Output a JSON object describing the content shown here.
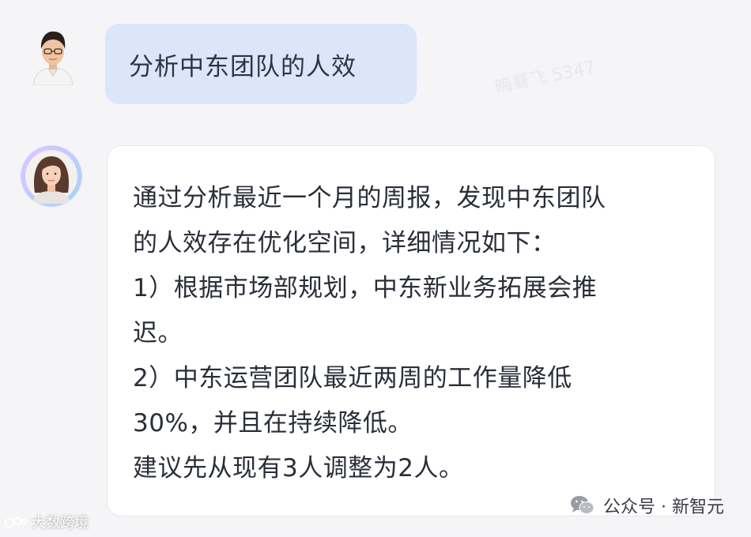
{
  "watermark": {
    "text": "晦蓦飞 5347"
  },
  "user_message": {
    "text": "分析中东团队的人效"
  },
  "ai_message": {
    "lines": [
      "通过分析最近一个月的周报，发现中东团队",
      "的人效存在优化空间，详细情况如下：",
      "1）根据市场部规划，中东新业务拓展会推",
      "迟。",
      "2）中东运营团队最近两周的工作量降低",
      "30%，并且在持续降低。",
      "建议先从现有3人调整为2人。"
    ]
  },
  "footer": {
    "left_brand": "大数跨境",
    "right_source": "公众号 · 新智元"
  },
  "colors": {
    "user_bubble": "#dbe6fb",
    "ai_bubble": "#ffffff",
    "background": "#f5f5f7"
  }
}
